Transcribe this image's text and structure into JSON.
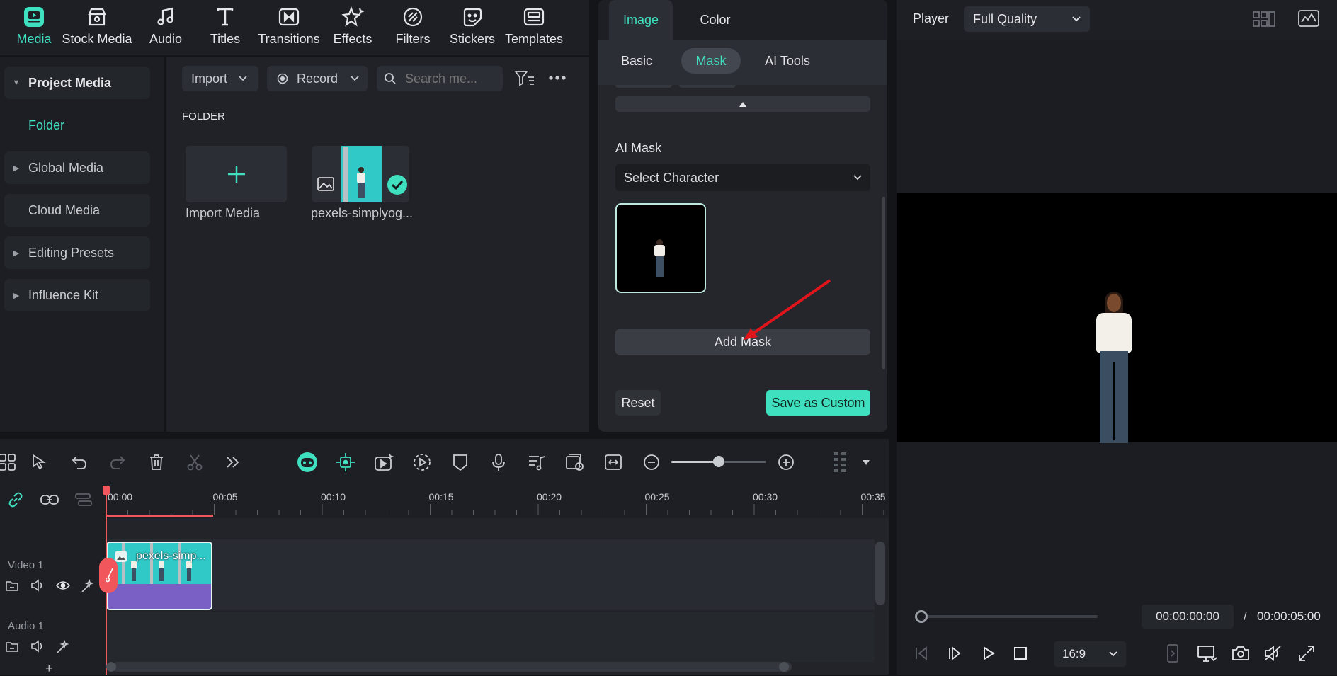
{
  "top_tabs": [
    {
      "label": "Media",
      "icon": "media-icon",
      "active": true
    },
    {
      "label": "Stock Media",
      "icon": "stock-media-icon"
    },
    {
      "label": "Audio",
      "icon": "music-note-icon"
    },
    {
      "label": "Titles",
      "icon": "titles-t-icon"
    },
    {
      "label": "Transitions",
      "icon": "transitions-icon"
    },
    {
      "label": "Effects",
      "icon": "effects-sparkle-icon"
    },
    {
      "label": "Filters",
      "icon": "filters-icon"
    },
    {
      "label": "Stickers",
      "icon": "stickers-icon"
    },
    {
      "label": "Templates",
      "icon": "templates-icon"
    }
  ],
  "sidebar": {
    "items": [
      {
        "label": "Project Media",
        "expanded": true
      },
      {
        "label": "Folder"
      },
      {
        "label": "Global Media"
      },
      {
        "label": "Cloud Media"
      },
      {
        "label": "Editing Presets"
      },
      {
        "label": "Influence Kit"
      }
    ]
  },
  "media": {
    "import_label": "Import",
    "record_label": "Record",
    "search_placeholder": "Search me...",
    "folder_heading": "FOLDER",
    "import_media_label": "Import Media",
    "clip_name": "pexels-simplyog..."
  },
  "props": {
    "tabs": [
      "Image",
      "Color"
    ],
    "active_tab": "Image",
    "subtabs": [
      "Basic",
      "Mask",
      "AI Tools"
    ],
    "active_subtab": "Mask",
    "ai_mask_label": "AI Mask",
    "select_character": "Select Character",
    "add_mask_label": "Add Mask",
    "reset_label": "Reset",
    "save_custom_label": "Save as Custom"
  },
  "player": {
    "label": "Player",
    "quality": "Full Quality",
    "current_time": "00:00:00:00",
    "separator": "/",
    "total_time": "00:00:05:00",
    "aspect": "16:9",
    "progress": 0.0
  },
  "timeline": {
    "ruler_labels": [
      "00:00",
      "00:05",
      "00:10",
      "00:15",
      "00:20",
      "00:25",
      "00:30",
      "00:35"
    ],
    "video_track": "Video 1",
    "audio_track": "Audio 1",
    "clip_label": "pexels-simp...",
    "zoom_level": 0.5
  },
  "colors": {
    "accent": "#3fe0c0",
    "playhead": "#f0565c",
    "clip_teal": "#31c9c8",
    "clip_purple": "#7a5fc4",
    "arrow": "#e0141b"
  }
}
